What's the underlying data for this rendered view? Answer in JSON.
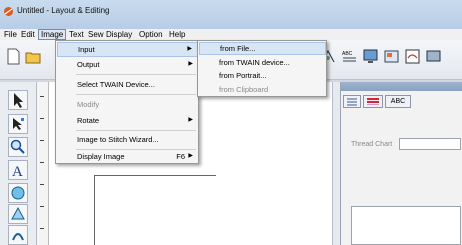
{
  "window": {
    "title": "Untitled - Layout & Editing"
  },
  "menubar": {
    "items": [
      {
        "label": "File"
      },
      {
        "label": "Edit"
      },
      {
        "label": "Image"
      },
      {
        "label": "Text"
      },
      {
        "label": "Sew"
      },
      {
        "label": "Display"
      },
      {
        "label": "Option"
      },
      {
        "label": "Help"
      }
    ]
  },
  "image_menu": {
    "items": [
      {
        "label": "Input",
        "submenu": true,
        "highlighted": true
      },
      {
        "label": "Output",
        "submenu": true
      },
      {
        "label": "Select TWAIN Device..."
      },
      {
        "label": "Modify",
        "disabled": true
      },
      {
        "label": "Rotate",
        "submenu": true
      },
      {
        "label": "Image to Stitch Wizard..."
      },
      {
        "label": "Display Image",
        "shortcut": "F6",
        "submenu": true
      }
    ]
  },
  "input_submenu": {
    "items": [
      {
        "label": "from File...",
        "highlighted": true
      },
      {
        "label": "from TWAIN device..."
      },
      {
        "label": "from Portrait..."
      },
      {
        "label": "from Clipboard",
        "disabled": true
      }
    ]
  },
  "right_panel": {
    "tab_abc": "ABC",
    "thread_chart_label": "Thread Chart"
  },
  "toolbar": {
    "icons": [
      "new-icon",
      "open-icon",
      "stitch-icon",
      "abc-text-icon",
      "monitor-icon",
      "card-icon",
      "sew-pattern-icon",
      "screen-icon"
    ]
  },
  "colors": {
    "titlebar": "#c9dbee",
    "menu_highlight": "#d7e5f5",
    "title_icon": "#e05a1e"
  }
}
